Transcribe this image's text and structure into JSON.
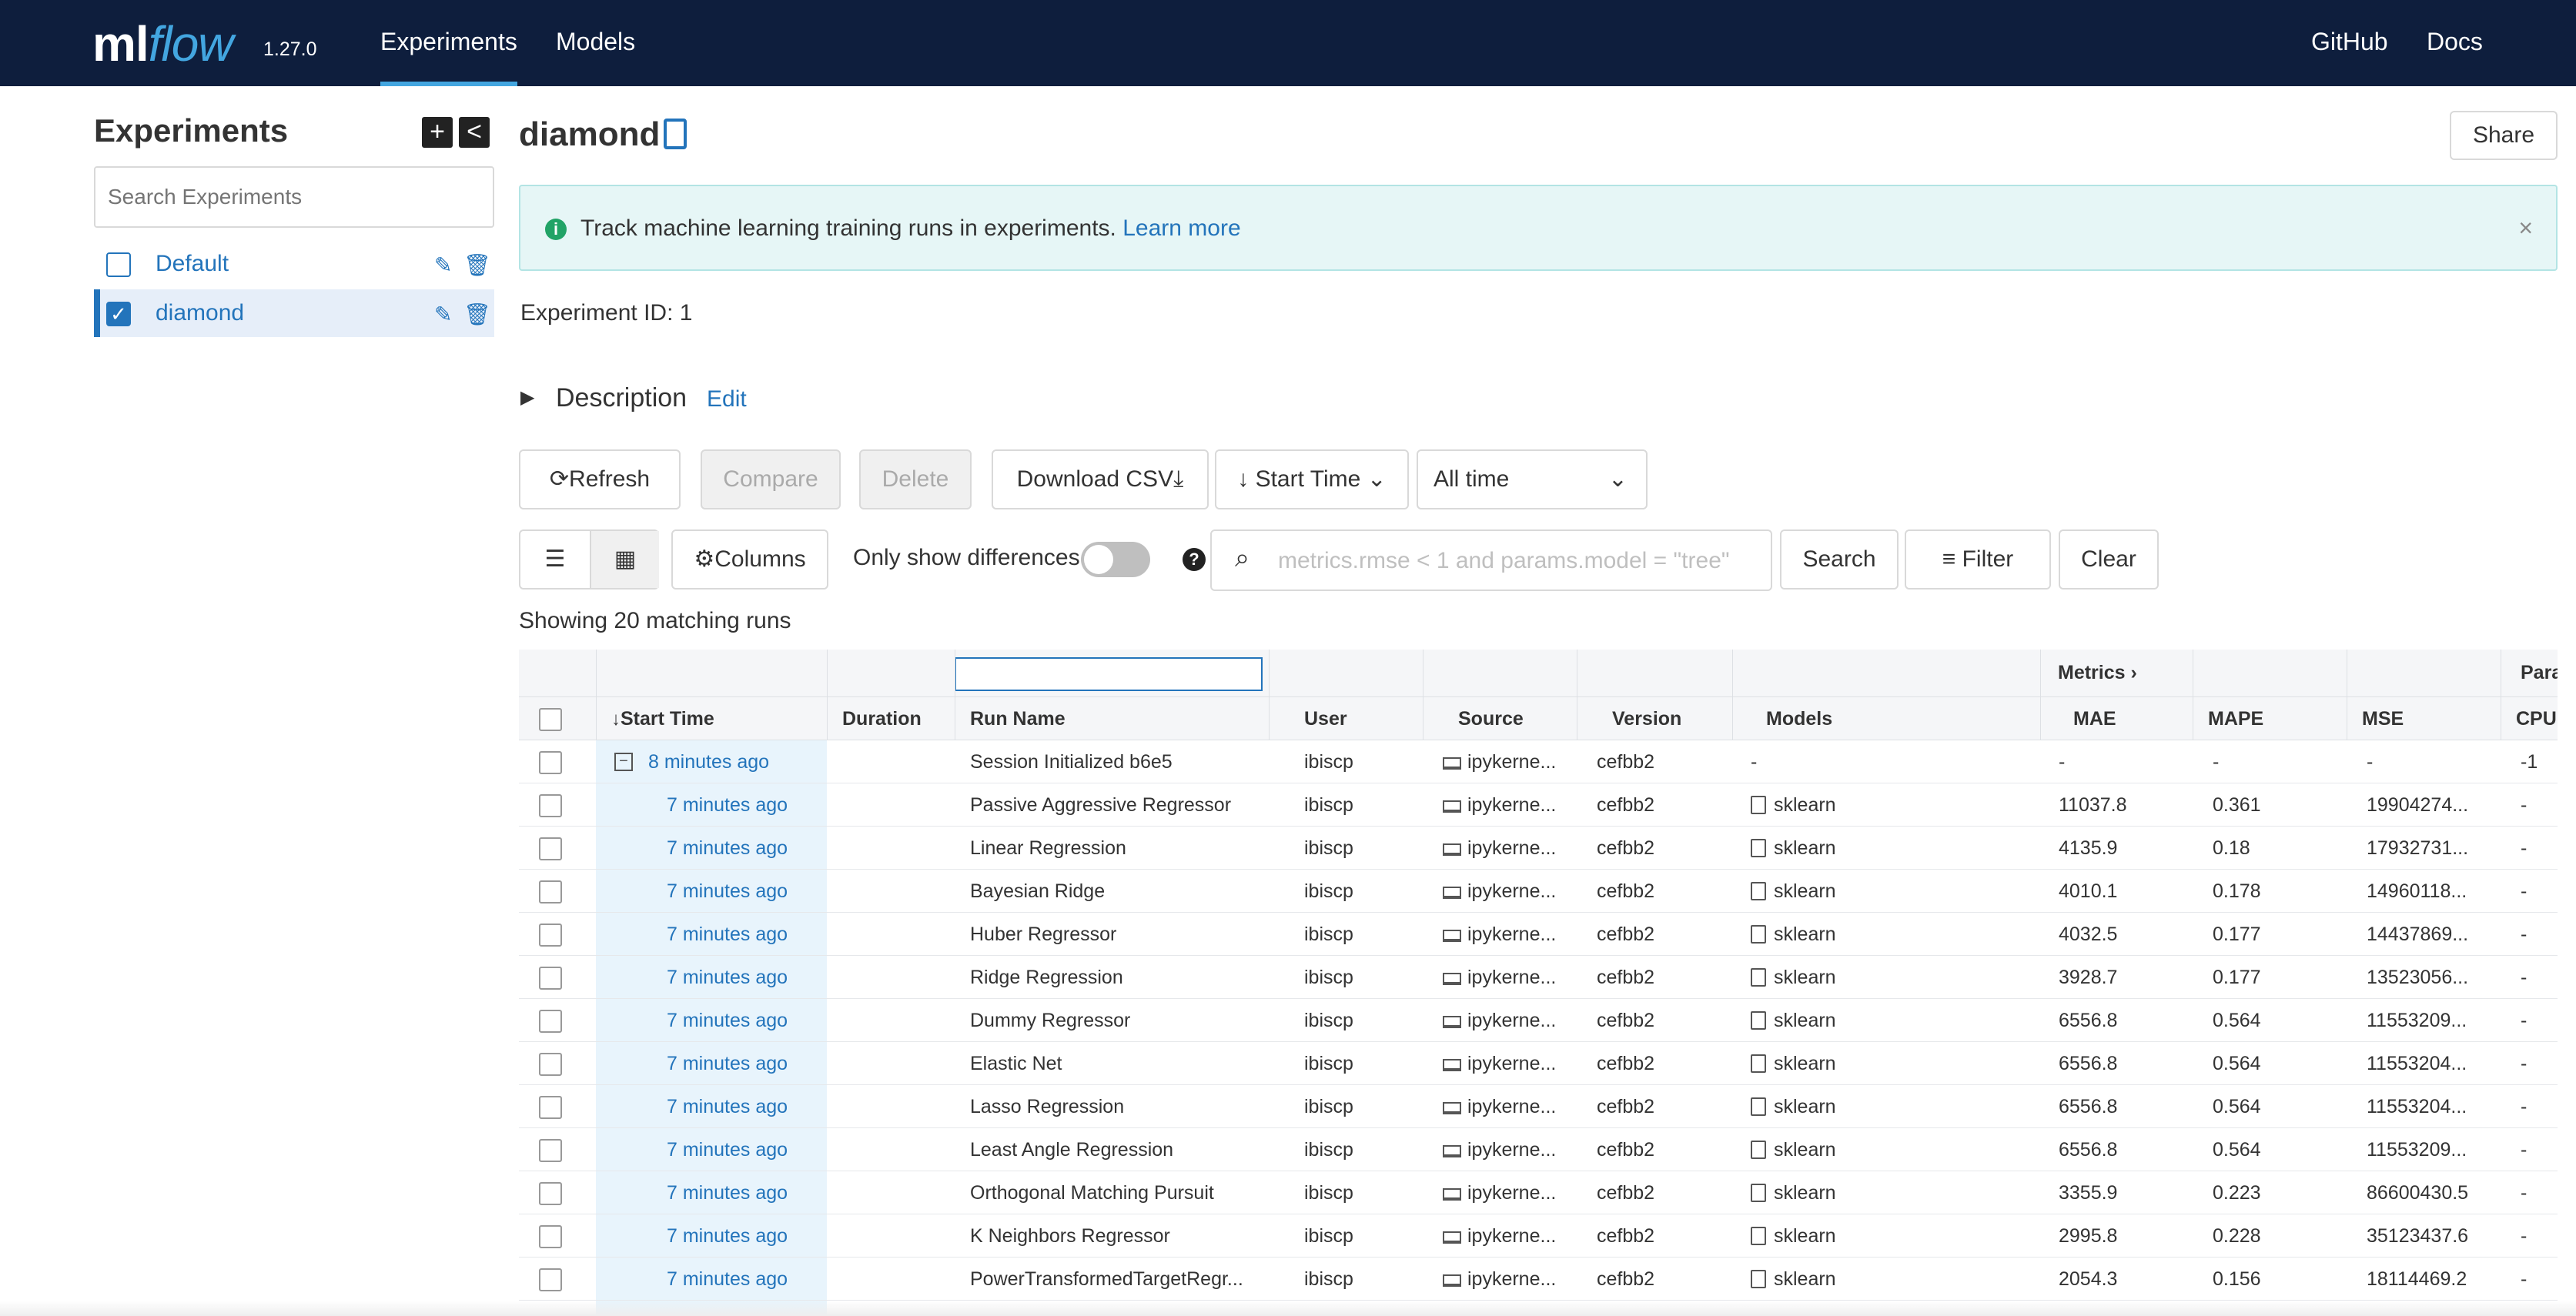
{
  "header": {
    "logo_ml": "ml",
    "logo_flow": "flow",
    "version": "1.27.0",
    "nav": [
      "Experiments",
      "Models"
    ],
    "nav_right": [
      "GitHub",
      "Docs"
    ]
  },
  "sidebar": {
    "title": "Experiments",
    "add_label": "+",
    "collapse_label": "<",
    "search_placeholder": "Search Experiments",
    "experiments": [
      {
        "name": "Default",
        "selected": false
      },
      {
        "name": "diamond",
        "selected": true
      }
    ]
  },
  "main": {
    "title": "diamond",
    "share_label": "Share",
    "alert_text": "Track machine learning training runs in experiments.",
    "alert_link": "Learn more",
    "alert_close": "×",
    "experiment_id": "Experiment ID:  1",
    "description_label": "Description",
    "edit_label": "Edit"
  },
  "toolbar": {
    "refresh": "Refresh",
    "compare": "Compare",
    "delete": "Delete",
    "download_csv": "Download CSV",
    "sort": "Start Time",
    "time_filter": "All time",
    "columns": "Columns",
    "only_diff": "Only show differences",
    "search_placeholder": "metrics.rmse < 1 and params.model = \"tree\"",
    "search": "Search",
    "filter": "Filter",
    "clear": "Clear",
    "help": "?"
  },
  "table": {
    "showing": "Showing 20 matching runs",
    "group_metrics": "Metrics",
    "group_params": "Para",
    "columns": [
      "Start Time",
      "Duration",
      "Run Name",
      "User",
      "Source",
      "Version",
      "Models",
      "MAE",
      "MAPE",
      "MSE",
      "CPU"
    ],
    "rows": [
      {
        "time": "8 minutes ago",
        "run": "Session Initialized b6e5",
        "user": "ibiscp",
        "source": "ipykerne...",
        "version": "cefbb2",
        "model": "-",
        "mae": "-",
        "mape": "-",
        "mse": "-",
        "cpu": "-1",
        "parent": true
      },
      {
        "time": "7 minutes ago",
        "run": "Passive Aggressive Regressor",
        "user": "ibiscp",
        "source": "ipykerne...",
        "version": "cefbb2",
        "model": "sklearn",
        "mae": "11037.8",
        "mape": "0.361",
        "mse": "19904274...",
        "cpu": "-"
      },
      {
        "time": "7 minutes ago",
        "run": "Linear Regression",
        "user": "ibiscp",
        "source": "ipykerne...",
        "version": "cefbb2",
        "model": "sklearn",
        "mae": "4135.9",
        "mape": "0.18",
        "mse": "17932731...",
        "cpu": "-"
      },
      {
        "time": "7 minutes ago",
        "run": "Bayesian Ridge",
        "user": "ibiscp",
        "source": "ipykerne...",
        "version": "cefbb2",
        "model": "sklearn",
        "mae": "4010.1",
        "mape": "0.178",
        "mse": "14960118...",
        "cpu": "-"
      },
      {
        "time": "7 minutes ago",
        "run": "Huber Regressor",
        "user": "ibiscp",
        "source": "ipykerne...",
        "version": "cefbb2",
        "model": "sklearn",
        "mae": "4032.5",
        "mape": "0.177",
        "mse": "14437869...",
        "cpu": "-"
      },
      {
        "time": "7 minutes ago",
        "run": "Ridge Regression",
        "user": "ibiscp",
        "source": "ipykerne...",
        "version": "cefbb2",
        "model": "sklearn",
        "mae": "3928.7",
        "mape": "0.177",
        "mse": "13523056...",
        "cpu": "-"
      },
      {
        "time": "7 minutes ago",
        "run": "Dummy Regressor",
        "user": "ibiscp",
        "source": "ipykerne...",
        "version": "cefbb2",
        "model": "sklearn",
        "mae": "6556.8",
        "mape": "0.564",
        "mse": "11553209...",
        "cpu": "-"
      },
      {
        "time": "7 minutes ago",
        "run": "Elastic Net",
        "user": "ibiscp",
        "source": "ipykerne...",
        "version": "cefbb2",
        "model": "sklearn",
        "mae": "6556.8",
        "mape": "0.564",
        "mse": "11553204...",
        "cpu": "-"
      },
      {
        "time": "7 minutes ago",
        "run": "Lasso Regression",
        "user": "ibiscp",
        "source": "ipykerne...",
        "version": "cefbb2",
        "model": "sklearn",
        "mae": "6556.8",
        "mape": "0.564",
        "mse": "11553204...",
        "cpu": "-"
      },
      {
        "time": "7 minutes ago",
        "run": "Least Angle Regression",
        "user": "ibiscp",
        "source": "ipykerne...",
        "version": "cefbb2",
        "model": "sklearn",
        "mae": "6556.8",
        "mape": "0.564",
        "mse": "11553209...",
        "cpu": "-"
      },
      {
        "time": "7 minutes ago",
        "run": "Orthogonal Matching Pursuit",
        "user": "ibiscp",
        "source": "ipykerne...",
        "version": "cefbb2",
        "model": "sklearn",
        "mae": "3355.9",
        "mape": "0.223",
        "mse": "86600430.5",
        "cpu": "-"
      },
      {
        "time": "7 minutes ago",
        "run": "K Neighbors Regressor",
        "user": "ibiscp",
        "source": "ipykerne...",
        "version": "cefbb2",
        "model": "sklearn",
        "mae": "2995.8",
        "mape": "0.228",
        "mse": "35123437.6",
        "cpu": "-"
      },
      {
        "time": "7 minutes ago",
        "run": "PowerTransformedTargetRegr...",
        "user": "ibiscp",
        "source": "ipykerne...",
        "version": "cefbb2",
        "model": "sklearn",
        "mae": "2054.3",
        "mape": "0.156",
        "mse": "18114469.2",
        "cpu": "-"
      }
    ]
  },
  "colors": {
    "header_bg": "#0e1e3d",
    "accent": "#2374bb",
    "alert_bg": "#e6f6f6"
  }
}
